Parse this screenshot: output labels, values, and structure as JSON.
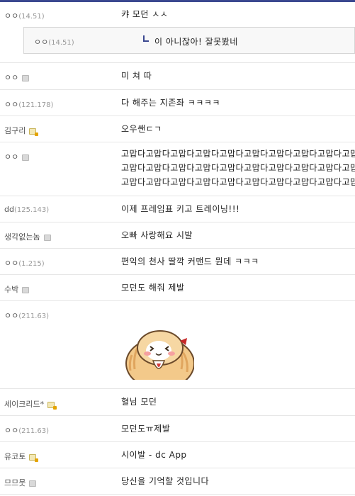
{
  "comments": [
    {
      "nick": "ㅇㅇ",
      "ip": "(14.51)",
      "icon": "",
      "lines": [
        "캬 모던 ㅅㅅ"
      ]
    },
    {
      "nick": "ㅇㅇ",
      "ip": "",
      "icon": "nick-icon",
      "lines": [
        "미 쳐 따"
      ]
    },
    {
      "nick": "ㅇㅇ",
      "ip": "(121.178)",
      "icon": "",
      "lines": [
        "다 해주는 지존좌 ㅋㅋㅋㅋ"
      ]
    },
    {
      "nick": "김구리",
      "ip": "",
      "icon": "fixed-nick-icon",
      "lines": [
        "오우쌘ㄷㄱ"
      ]
    },
    {
      "nick": "ㅇㅇ",
      "ip": "",
      "icon": "nick-icon",
      "lines": [
        "고맙다고맙다고맙다고맙다고맙다고맙다고맙다고맙다고맙다고맙다고맙다",
        "고맙다고맙다고맙다고맙다고맙다고맙다고맙다고맙다고맙다고맙다고맙다",
        "고맙다고맙다고맙다고맙다고맙다고맙다고맙다고맙다고맙다고맙다고맙다"
      ]
    },
    {
      "nick": "dd",
      "ip": "(125.143)",
      "icon": "",
      "lines": [
        "이제 프레임표 키고 트레이닝!!!"
      ]
    },
    {
      "nick": "생각없는놈",
      "ip": "",
      "icon": "nick-icon",
      "lines": [
        "오빠 사랑해요 시발"
      ]
    },
    {
      "nick": "ㅇㅇ",
      "ip": "(1.215)",
      "icon": "",
      "lines": [
        "편익의 천사 딸깍 커맨드 뭔데 ㅋㅋㅋ"
      ]
    },
    {
      "nick": "수박",
      "ip": "",
      "icon": "nick-icon",
      "lines": [
        "모던도 해줘 제발"
      ]
    },
    {
      "nick": "ㅇㅇ",
      "ip": "(211.63)",
      "icon": "",
      "lines": []
    },
    {
      "nick": "세이크리드*",
      "ip": "",
      "icon": "fixed-nick-icon",
      "lines": [
        "혈님 모던"
      ]
    },
    {
      "nick": "ㅇㅇ",
      "ip": "(211.63)",
      "icon": "",
      "lines": [
        "모던도ㅠ제발"
      ]
    },
    {
      "nick": "유코토",
      "ip": "",
      "icon": "fixed-nick-icon",
      "lines": [
        "시이발 - dc App"
      ]
    },
    {
      "nick": "므므뭇",
      "ip": "",
      "icon": "nick-icon",
      "lines": [
        "당신을 기억할 것입니다"
      ]
    }
  ],
  "reply": {
    "nick": "ㅇㅇ",
    "ip": "(14.51)",
    "text": "이 아니잖아! 잘못봤네"
  },
  "colors": {
    "accent": "#3b4890",
    "divider": "#e6e6e6",
    "ip": "#999999"
  }
}
